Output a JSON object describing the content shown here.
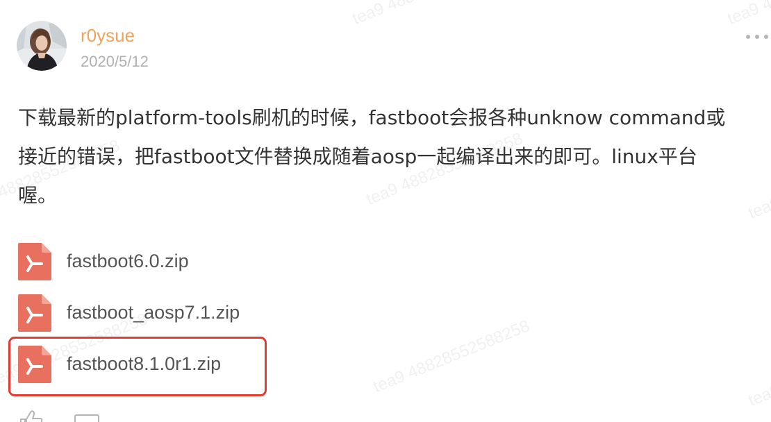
{
  "watermark": {
    "text": "tea9 48828552588258"
  },
  "post": {
    "author": {
      "name": "r0ysue",
      "avatar_icon": "avatar-portrait-icon"
    },
    "date": "2020/5/12",
    "more_icon": "more-dots-icon",
    "content_lines": [
      "下载最新的platform-tools刷机的时候，fastboot会报各种unknow command或",
      "接近的错误，把fastboot文件替换成随着aosp一起编译出来的即可。linux平台",
      "喔。"
    ],
    "attachments": [
      {
        "name": "fastboot6.0.zip",
        "icon": "zip-file-icon"
      },
      {
        "name": "fastboot_aosp7.1.zip",
        "icon": "zip-file-icon"
      },
      {
        "name": "fastboot8.1.0r1.zip",
        "icon": "zip-file-icon"
      }
    ],
    "highlighted_attachment_index": 2,
    "actions": {
      "like_icon": "thumbs-up-icon",
      "comment_icon": "comment-icon"
    }
  },
  "colors": {
    "username": "#f0a35c",
    "date": "#b0b0b0",
    "body_text": "#333333",
    "file_icon": "#e8705f",
    "highlight_border": "#e53a2f"
  }
}
